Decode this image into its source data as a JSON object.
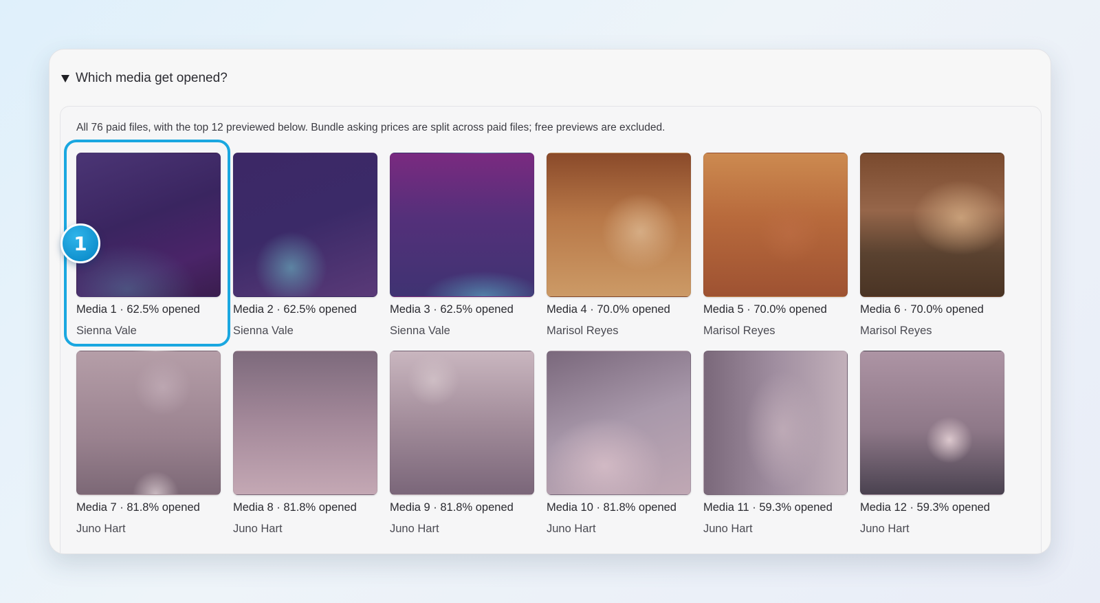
{
  "section": {
    "title": "Which media get opened?",
    "description": "All 76 paid files, with the top 12 previewed below. Bundle asking prices are split across paid files; free previews are excluded."
  },
  "media": [
    {
      "caption": "Media 1 · 62.5% opened",
      "creator": "Sienna Vale"
    },
    {
      "caption": "Media 2 · 62.5% opened",
      "creator": "Sienna Vale"
    },
    {
      "caption": "Media 3 · 62.5% opened",
      "creator": "Sienna Vale"
    },
    {
      "caption": "Media 4 · 70.0% opened",
      "creator": "Marisol Reyes"
    },
    {
      "caption": "Media 5 · 70.0% opened",
      "creator": "Marisol Reyes"
    },
    {
      "caption": "Media 6 · 70.0% opened",
      "creator": "Marisol Reyes"
    },
    {
      "caption": "Media 7 · 81.8% opened",
      "creator": "Juno Hart"
    },
    {
      "caption": "Media 8 · 81.8% opened",
      "creator": "Juno Hart"
    },
    {
      "caption": "Media 9 · 81.8% opened",
      "creator": "Juno Hart"
    },
    {
      "caption": "Media 10 · 81.8% opened",
      "creator": "Juno Hart"
    },
    {
      "caption": "Media 11 · 59.3% opened",
      "creator": "Juno Hart"
    },
    {
      "caption": "Media 12 · 59.3% opened",
      "creator": "Juno Hart"
    }
  ],
  "annotation": {
    "step_number": "1",
    "accent_color": "#1aa7e0"
  }
}
